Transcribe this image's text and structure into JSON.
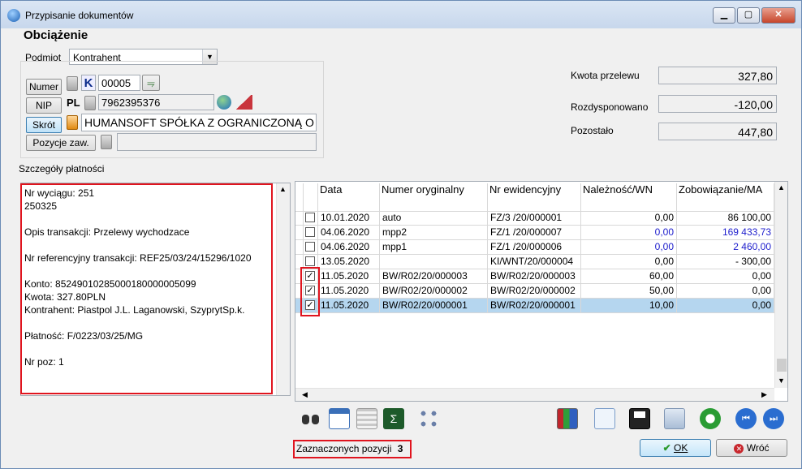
{
  "window": {
    "title": "Przypisanie dokumentów",
    "controls": {
      "minimize": "▁",
      "maximize": "▢",
      "close": "✕"
    }
  },
  "heading": "Obciążenie",
  "podmiot": {
    "label": "Podmiot",
    "value": "Kontrahent"
  },
  "buttons": {
    "numer": "Numer",
    "nip": "NIP",
    "skrot": "Skrót",
    "pozycje": "Pozycje zaw."
  },
  "fields": {
    "k_label": "K",
    "numer_value": "00005",
    "nip_prefix": "PL",
    "nip_value": "7962395376",
    "skrot_value": "HUMANSOFT SPÓŁKA Z OGRANICZONĄ O",
    "pozycje_value": ""
  },
  "amounts": [
    {
      "label": "Kwota przelewu",
      "value": "327,80"
    },
    {
      "label": "Rozdysponowano",
      "value": "-120,00"
    },
    {
      "label": "Pozostało",
      "value": "447,80"
    }
  ],
  "details": {
    "label": "Szczegóły płatności",
    "text": "Nr wyciągu: 251\n250325\n\nOpis transakcji: Przelewy wychodzace\n\nNr referencyjny transakcji: REF25/03/24/15296/1020\n\nKonto: 85249010285000180000005099\nKwota: 327.80PLN\nKontrahent: Piastpol J.L. Laganowski, SzyprytSp.k.\n\nPłatność: F/0223/03/25/MG\n\nNr poz: 1"
  },
  "grid": {
    "columns": [
      "Data",
      "Numer oryginalny",
      "Nr ewidencyjny",
      "Należność/WN",
      "Zobowiązanie/MA"
    ],
    "rows": [
      {
        "checked": false,
        "date": "10.01.2020",
        "orig": "auto",
        "ewid": "FZ/3  /20/000001",
        "wn": "0,00",
        "ma": "86 100,00",
        "blue": false,
        "selected": false
      },
      {
        "checked": false,
        "date": "04.06.2020",
        "orig": "mpp2",
        "ewid": "FZ/1  /20/000007",
        "wn": "0,00",
        "ma": "169 433,73",
        "blue": true,
        "selected": false
      },
      {
        "checked": false,
        "date": "04.06.2020",
        "orig": "mpp1",
        "ewid": "FZ/1  /20/000006",
        "wn": "0,00",
        "ma": "2 460,00",
        "blue": true,
        "selected": false
      },
      {
        "checked": false,
        "date": "13.05.2020",
        "orig": "",
        "ewid": "KI/WNT/20/000004",
        "wn": "0,00",
        "ma": "- 300,00",
        "blue": false,
        "selected": false
      },
      {
        "checked": true,
        "date": "11.05.2020",
        "orig": "BW/R02/20/000003",
        "ewid": "BW/R02/20/000003",
        "wn": "60,00",
        "ma": "0,00",
        "blue": false,
        "selected": false
      },
      {
        "checked": true,
        "date": "11.05.2020",
        "orig": "BW/R02/20/000002",
        "ewid": "BW/R02/20/000002",
        "wn": "50,00",
        "ma": "0,00",
        "blue": false,
        "selected": false
      },
      {
        "checked": true,
        "date": "11.05.2020",
        "orig": "BW/R02/20/000001",
        "ewid": "BW/R02/20/000001",
        "wn": "10,00",
        "ma": "0,00",
        "blue": false,
        "selected": true
      }
    ]
  },
  "status": {
    "label": "Zaznaczonych pozycji",
    "count": "3"
  },
  "actions": {
    "ok": "OK",
    "cancel": "Wróć"
  },
  "icons": {
    "left_toolbar": [
      "binoculars-icon",
      "calendar-filter-icon",
      "documents-icon",
      "sum-icon",
      "network-icon"
    ],
    "right_toolbar": [
      "chart-icon",
      "document-edit-icon",
      "save-icon",
      "copy-icon",
      "refresh-icon",
      "previous-icon",
      "next-icon"
    ]
  }
}
